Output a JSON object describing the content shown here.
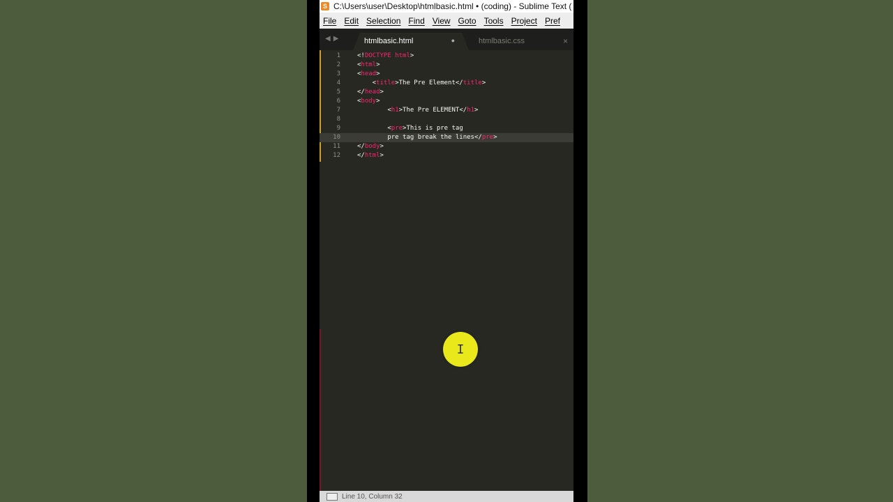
{
  "window": {
    "title": "C:\\Users\\user\\Desktop\\htmlbasic.html • (coding) - Sublime Text ("
  },
  "menu": [
    "File",
    "Edit",
    "Selection",
    "Find",
    "View",
    "Goto",
    "Tools",
    "Project",
    "Pref"
  ],
  "tabs": [
    {
      "label": "htmlbasic.html",
      "active": true,
      "modified_indicator": "●"
    },
    {
      "label": "htmlbasic.css",
      "active": false,
      "close": "×"
    }
  ],
  "code": {
    "lines": [
      {
        "n": "1",
        "parts": [
          [
            "p",
            "<!"
          ],
          [
            "t",
            "DOCTYPE"
          ],
          [
            "p",
            " "
          ],
          [
            "t",
            "html"
          ],
          [
            "p",
            ">"
          ]
        ]
      },
      {
        "n": "2",
        "parts": [
          [
            "p",
            "<"
          ],
          [
            "t",
            "html"
          ],
          [
            "p",
            ">"
          ]
        ]
      },
      {
        "n": "3",
        "parts": [
          [
            "p",
            "<"
          ],
          [
            "t",
            "head"
          ],
          [
            "p",
            ">"
          ]
        ]
      },
      {
        "n": "4",
        "parts": [
          [
            "p",
            "    <"
          ],
          [
            "t",
            "title"
          ],
          [
            "p",
            ">The Pre Element</"
          ],
          [
            "t",
            "title"
          ],
          [
            "p",
            ">"
          ]
        ]
      },
      {
        "n": "5",
        "parts": [
          [
            "p",
            "</"
          ],
          [
            "t",
            "head"
          ],
          [
            "p",
            ">"
          ]
        ]
      },
      {
        "n": "6",
        "parts": [
          [
            "p",
            "<"
          ],
          [
            "t",
            "body"
          ],
          [
            "p",
            ">"
          ]
        ]
      },
      {
        "n": "7",
        "parts": [
          [
            "p",
            "        <"
          ],
          [
            "t",
            "h1"
          ],
          [
            "p",
            ">The Pre ELEMENT</"
          ],
          [
            "t",
            "h1"
          ],
          [
            "p",
            ">"
          ]
        ]
      },
      {
        "n": "8",
        "parts": []
      },
      {
        "n": "9",
        "parts": [
          [
            "p",
            "        <"
          ],
          [
            "t",
            "pre"
          ],
          [
            "p",
            ">This is pre tag"
          ]
        ]
      },
      {
        "n": "10",
        "parts": [
          [
            "p",
            "        pre tag break the lines</"
          ],
          [
            "t",
            "pre"
          ],
          [
            "p",
            ">"
          ]
        ],
        "current": true
      },
      {
        "n": "11",
        "parts": [
          [
            "p",
            "</"
          ],
          [
            "t",
            "body"
          ],
          [
            "p",
            ">"
          ]
        ]
      },
      {
        "n": "12",
        "parts": [
          [
            "p",
            "</"
          ],
          [
            "t",
            "html"
          ],
          [
            "p",
            ">"
          ]
        ]
      }
    ]
  },
  "status": {
    "text": "Line 10, Column 32"
  },
  "colors": {
    "tag": "#f92672",
    "text": "#f8f8f2",
    "background": "#272822",
    "cursor_highlight": "#e8e81a"
  },
  "icons": {
    "app": "sublime-text-icon",
    "cursor": "ibeam-icon"
  },
  "app_icon_glyph": "S",
  "nav_arrows": "◀▶",
  "cursor_glyph": "I"
}
